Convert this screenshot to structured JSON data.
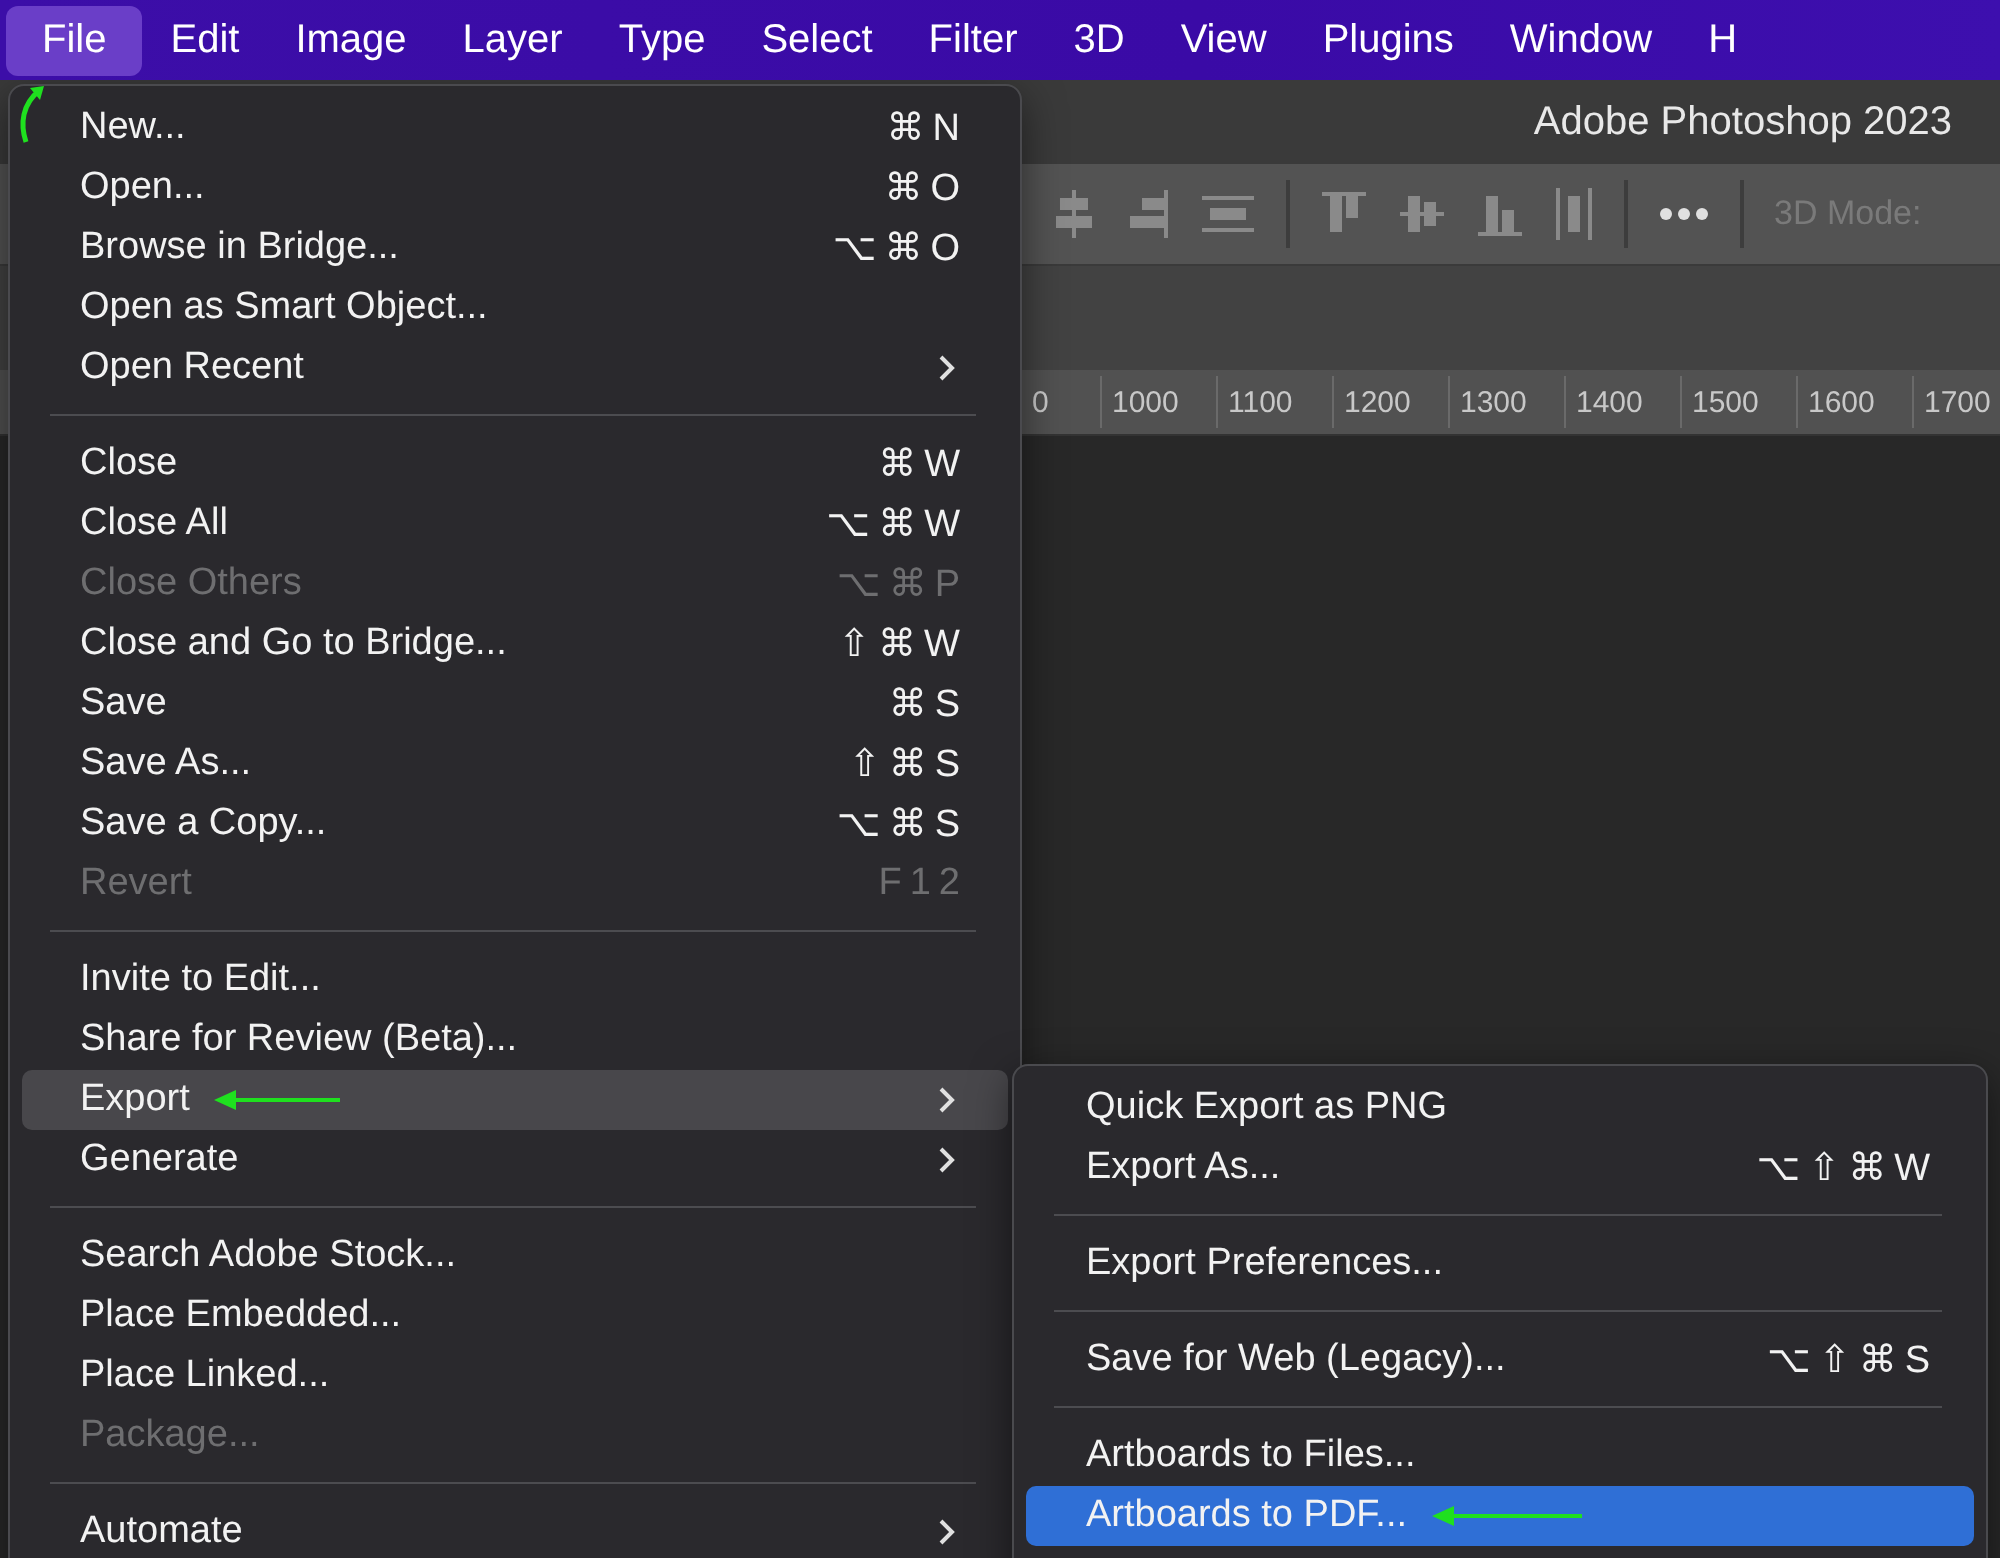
{
  "menu_bar": {
    "items": [
      {
        "label": "File",
        "selected": true
      },
      {
        "label": "Edit",
        "selected": false
      },
      {
        "label": "Image",
        "selected": false
      },
      {
        "label": "Layer",
        "selected": false
      },
      {
        "label": "Type",
        "selected": false
      },
      {
        "label": "Select",
        "selected": false
      },
      {
        "label": "Filter",
        "selected": false
      },
      {
        "label": "3D",
        "selected": false
      },
      {
        "label": "View",
        "selected": false
      },
      {
        "label": "Plugins",
        "selected": false
      },
      {
        "label": "Window",
        "selected": false
      },
      {
        "label": "H",
        "selected": false
      }
    ],
    "curved_arrow": true
  },
  "app": {
    "title": "Adobe Photoshop 2023",
    "toolbar": {
      "mode_label": "3D Mode:"
    },
    "ruler": {
      "labels": [
        "0",
        "1000",
        "1100",
        "1200",
        "1300",
        "1400",
        "1500",
        "1600",
        "1700"
      ]
    }
  },
  "file_menu": {
    "items": [
      {
        "kind": "item",
        "label": "New...",
        "shortcut": "⌘N",
        "disabled": false,
        "submenu": false,
        "selected": false,
        "pointer": false
      },
      {
        "kind": "item",
        "label": "Open...",
        "shortcut": "⌘O",
        "disabled": false,
        "submenu": false,
        "selected": false,
        "pointer": false
      },
      {
        "kind": "item",
        "label": "Browse in Bridge...",
        "shortcut": "⌥⌘O",
        "disabled": false,
        "submenu": false,
        "selected": false,
        "pointer": false
      },
      {
        "kind": "item",
        "label": "Open as Smart Object...",
        "disabled": false,
        "submenu": false,
        "selected": false,
        "pointer": false
      },
      {
        "kind": "item",
        "label": "Open Recent",
        "disabled": false,
        "submenu": true,
        "selected": false,
        "pointer": false
      },
      {
        "kind": "separator"
      },
      {
        "kind": "item",
        "label": "Close",
        "shortcut": "⌘W",
        "disabled": false,
        "submenu": false,
        "selected": false,
        "pointer": false
      },
      {
        "kind": "item",
        "label": "Close All",
        "shortcut": "⌥⌘W",
        "disabled": false,
        "submenu": false,
        "selected": false,
        "pointer": false
      },
      {
        "kind": "item",
        "label": "Close Others",
        "shortcut": "⌥⌘P",
        "disabled": true,
        "submenu": false,
        "selected": false,
        "pointer": false
      },
      {
        "kind": "item",
        "label": "Close and Go to Bridge...",
        "shortcut": "⇧⌘W",
        "disabled": false,
        "submenu": false,
        "selected": false,
        "pointer": false
      },
      {
        "kind": "item",
        "label": "Save",
        "shortcut": "⌘S",
        "disabled": false,
        "submenu": false,
        "selected": false,
        "pointer": false
      },
      {
        "kind": "item",
        "label": "Save As...",
        "shortcut": "⇧⌘S",
        "disabled": false,
        "submenu": false,
        "selected": false,
        "pointer": false
      },
      {
        "kind": "item",
        "label": "Save a Copy...",
        "shortcut": "⌥⌘S",
        "disabled": false,
        "submenu": false,
        "selected": false,
        "pointer": false
      },
      {
        "kind": "item",
        "label": "Revert",
        "shortcut": "F12",
        "disabled": true,
        "submenu": false,
        "selected": false,
        "pointer": false
      },
      {
        "kind": "separator"
      },
      {
        "kind": "item",
        "label": "Invite to Edit...",
        "disabled": false,
        "submenu": false,
        "selected": false,
        "pointer": false
      },
      {
        "kind": "item",
        "label": "Share for Review (Beta)...",
        "disabled": false,
        "submenu": false,
        "selected": false,
        "pointer": false
      },
      {
        "kind": "item",
        "label": "Export",
        "disabled": false,
        "submenu": true,
        "selected": true,
        "pointer": true
      },
      {
        "kind": "item",
        "label": "Generate",
        "disabled": false,
        "submenu": true,
        "selected": false,
        "pointer": false
      },
      {
        "kind": "separator"
      },
      {
        "kind": "item",
        "label": "Search Adobe Stock...",
        "disabled": false,
        "submenu": false,
        "selected": false,
        "pointer": false
      },
      {
        "kind": "item",
        "label": "Place Embedded...",
        "disabled": false,
        "submenu": false,
        "selected": false,
        "pointer": false
      },
      {
        "kind": "item",
        "label": "Place Linked...",
        "disabled": false,
        "submenu": false,
        "selected": false,
        "pointer": false
      },
      {
        "kind": "item",
        "label": "Package...",
        "disabled": true,
        "submenu": false,
        "selected": false,
        "pointer": false
      },
      {
        "kind": "separator"
      },
      {
        "kind": "item",
        "label": "Automate",
        "disabled": false,
        "submenu": true,
        "selected": false,
        "pointer": false
      }
    ]
  },
  "export_submenu": {
    "items": [
      {
        "kind": "item",
        "label": "Quick Export as PNG",
        "disabled": false,
        "submenu": false,
        "selected": false,
        "pointer": false
      },
      {
        "kind": "item",
        "label": "Export As...",
        "shortcut": "⌥⇧⌘W",
        "disabled": false,
        "submenu": false,
        "selected": false,
        "pointer": false
      },
      {
        "kind": "separator"
      },
      {
        "kind": "item",
        "label": "Export Preferences...",
        "disabled": false,
        "submenu": false,
        "selected": false,
        "pointer": false
      },
      {
        "kind": "separator"
      },
      {
        "kind": "item",
        "label": "Save for Web (Legacy)...",
        "shortcut": "⌥⇧⌘S",
        "disabled": false,
        "submenu": false,
        "selected": false,
        "pointer": false
      },
      {
        "kind": "separator"
      },
      {
        "kind": "item",
        "label": "Artboards to Files...",
        "disabled": false,
        "submenu": false,
        "selected": false,
        "pointer": false
      },
      {
        "kind": "item",
        "label": "Artboards to PDF...",
        "disabled": false,
        "submenu": false,
        "selected": true,
        "pointer": true
      }
    ]
  }
}
